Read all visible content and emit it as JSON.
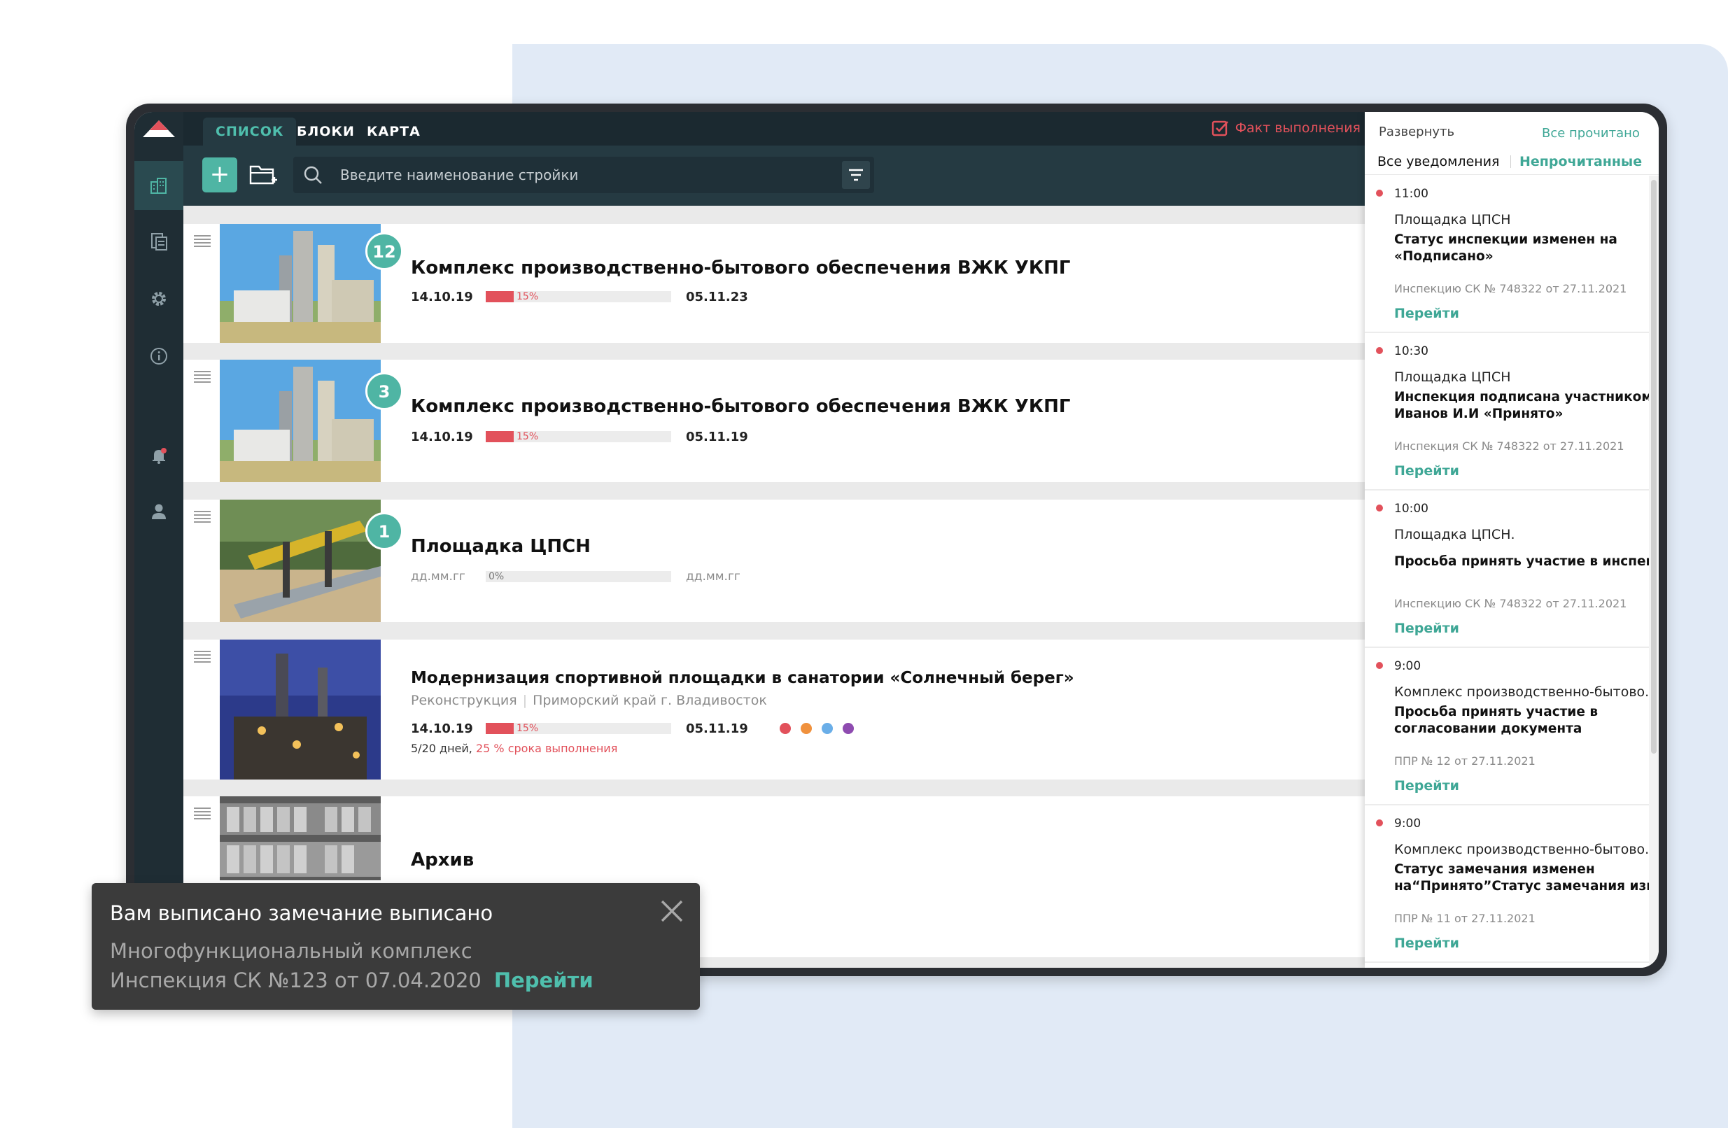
{
  "tabs": {
    "list": "СПИСОК",
    "blocks": "БЛОКИ",
    "map": "КАРТА"
  },
  "fact_label": "Факт выполнения",
  "search": {
    "placeholder": "Введите наименование стройки"
  },
  "projects": [
    {
      "badge": "12",
      "title": "Комплекс производственно-бытового обеспечения ВЖК УКПГ",
      "start": "14.10.19",
      "end": "05.11.23",
      "progress": 15,
      "progress_label": "15%"
    },
    {
      "badge": "3",
      "title": "Комплекс производственно-бытового обеспечения ВЖК УКПГ",
      "start": "14.10.19",
      "end": "05.11.19",
      "progress": 15,
      "progress_label": "15%"
    },
    {
      "badge": "1",
      "title": "Площадка ЦПСН",
      "start": "дд.мм.гг",
      "end": "дд.мм.гг",
      "progress": 0,
      "progress_label": "0%"
    },
    {
      "title": "Модернизация спортивной площадки в санатории «Солнечный берег»",
      "type": "Реконструкция",
      "location": "Приморский край г. Владивосток",
      "start": "14.10.19",
      "end": "05.11.19",
      "progress": 15,
      "progress_label": "15%",
      "days": "5/20 дней,",
      "term": "25 % срока выполнения",
      "status_colors": [
        "#e2515b",
        "#f0913d",
        "#6aaee8",
        "#8e4bb0"
      ]
    },
    {
      "title": "Архив"
    }
  ],
  "notifications_panel": {
    "expand": "Развернуть",
    "all_read": "Все прочитано",
    "tab_all": "Все уведомления",
    "tab_unread": "Непрочитанные",
    "items": [
      {
        "time": "11:00",
        "place": "Площадка ЦПСН",
        "message": "Статус инспекции изменен на «Подписано»",
        "ref": "Инспекцию СК № 748322 от 27.11.2021",
        "link": "Перейти"
      },
      {
        "time": "10:30",
        "place": "Площадка ЦПСН",
        "message": "Инспекция подписана участником: Иванов И.И «Принято»",
        "ref": "Инспекция СК № 748322 от 27.11.2021",
        "link": "Перейти"
      },
      {
        "time": "10:00",
        "place": "Площадка ЦПСН.",
        "message": "Просьба принять участие в инспекции",
        "ref": "Инспекцию СК № 748322 от 27.11.2021",
        "link": "Перейти"
      },
      {
        "time": "9:00",
        "place": "Комплекс производственно-бытово..",
        "message": "Просьба принять участие в согласовании документа",
        "ref": "ППР № 12 от 27.11.2021",
        "link": "Перейти"
      },
      {
        "time": "9:00",
        "place": "Комплекс производственно-бытово..",
        "message": "Статус замечания изменен на“Принято”Статус замечания изменен",
        "ref": "ППР № 11 от 27.11.2021",
        "link": "Перейти"
      }
    ]
  },
  "toast": {
    "title": "Вам выписано замечание выписано",
    "line1": "Многофункциональный комплекс",
    "line2": "Инспекция СК №123 от 07.04.2020",
    "link": "Перейти"
  },
  "colors": {
    "accent": "#4fb5a4",
    "danger": "#e2515b",
    "rail": "#1f2d34",
    "topbar": "#1b2930"
  }
}
